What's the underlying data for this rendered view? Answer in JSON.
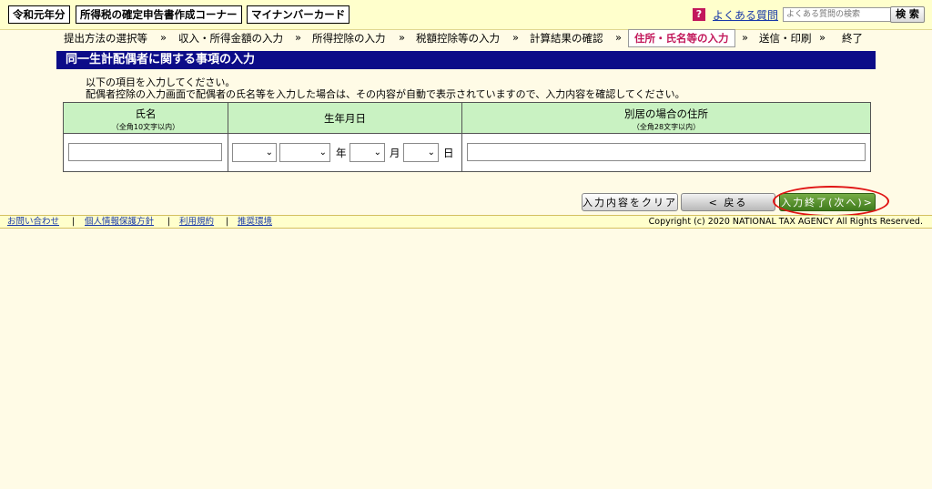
{
  "header": {
    "badges": [
      "令和元年分",
      "所得税の確定申告書作成コーナー",
      "マイナンバーカード"
    ],
    "help_icon": "?",
    "faq_link": "よくある質問",
    "search_placeholder": "よくある質問の検索",
    "search_button": "検 索"
  },
  "steps": {
    "items": [
      "提出方法の選択等",
      "収入・所得金額の入力",
      "所得控除の入力",
      "税額控除等の入力",
      "計算結果の確認",
      "住所・氏名等の入力",
      "送信・印刷",
      "終了"
    ],
    "separator": "»",
    "current_index": 5
  },
  "section": {
    "title": "同一生計配偶者に関する事項の入力",
    "instruction_1": "以下の項目を入力してください。",
    "instruction_2": "配偶者控除の入力画面で配偶者の氏名等を入力した場合は、その内容が自動で表示されていますので、入力内容を確認してください。"
  },
  "table": {
    "headers": [
      {
        "label": "氏名",
        "sub": "（全角10文字以内）"
      },
      {
        "label": "生年月日",
        "sub": ""
      },
      {
        "label": "別居の場合の住所",
        "sub": "（全角28文字以内）"
      }
    ],
    "name_value": "",
    "address_value": "",
    "date_units": {
      "year": "年",
      "month": "月",
      "day": "日"
    }
  },
  "buttons": {
    "clear": "入力内容をクリア",
    "back": "< 戻る",
    "next": "入力終了(次へ)>"
  },
  "footer": {
    "links": [
      "お問い合わせ",
      "個人情報保護方針",
      "利用規約",
      "推奨環境"
    ],
    "separator": "|",
    "copyright": "Copyright (c) 2020 NATIONAL TAX AGENCY All Rights Reserved."
  },
  "colors": {
    "header_bg": "#ffffcc",
    "page_bg": "#fffbe6",
    "title_bar": "#0c0c88",
    "table_header": "#c9f2c2",
    "current_step": "#c2185b",
    "next_button": "#4e8a2a",
    "highlight_oval": "#e01414"
  }
}
